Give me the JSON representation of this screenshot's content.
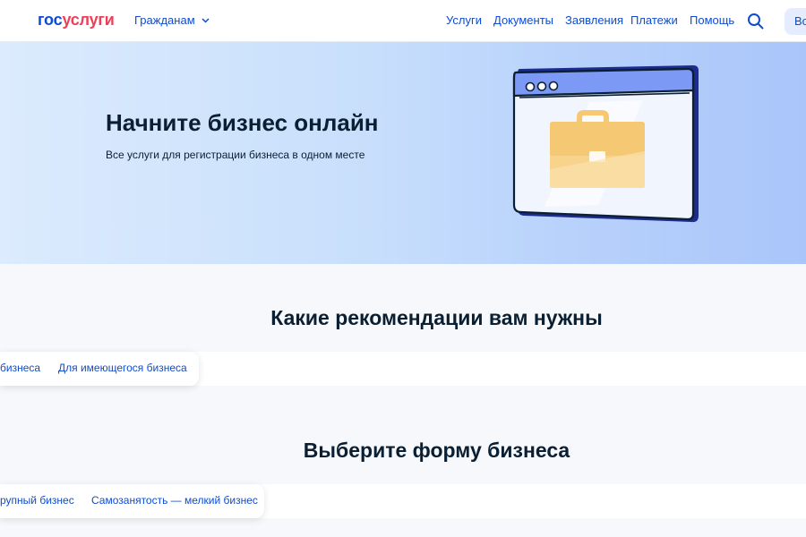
{
  "header": {
    "logo_part1": "гос",
    "logo_part2": "услуги",
    "audience_label": "Гражданам",
    "nav": [
      "Услуги",
      "Документы",
      "Заявления",
      "Платежи",
      "Помощь"
    ],
    "login_label": "Войти",
    "search_icon": "search-icon"
  },
  "hero": {
    "title": "Начните бизнес онлайн",
    "subtitle": "Все услуги для регистрации бизнеса в одном месте",
    "illustration": "browser-window-with-briefcase"
  },
  "recommendations": {
    "title": "Какие рекомендации вам нужны",
    "tabs": [
      "бизнеса",
      "Для имеющегося бизнеса"
    ]
  },
  "business_form": {
    "title": "Выберите форму бизнеса",
    "tabs": [
      "рупный бизнес",
      "Самозанятость — мелкий бизнес"
    ]
  },
  "colors": {
    "brand_blue": "#0d4cd3",
    "brand_red": "#ee3f58",
    "text_dark": "#0b1f33"
  }
}
